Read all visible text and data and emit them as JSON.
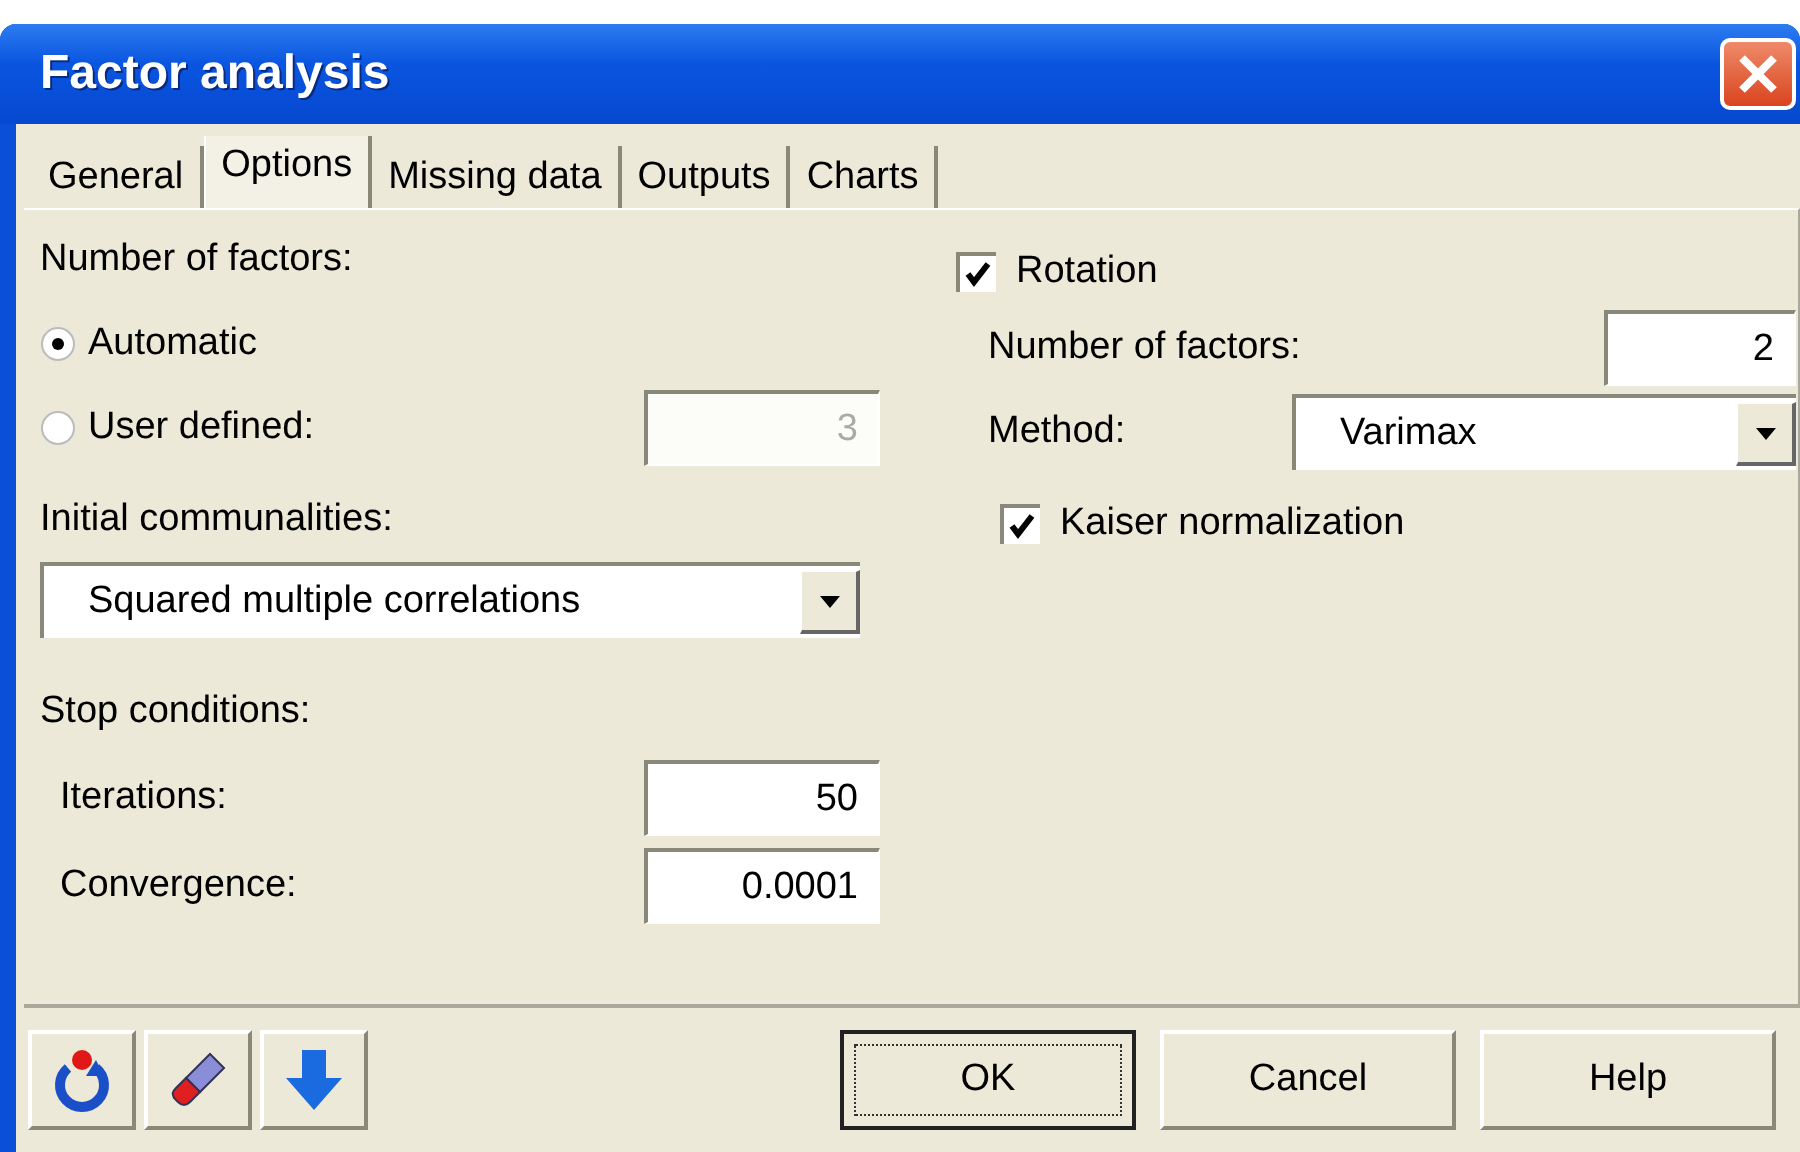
{
  "window": {
    "title": "Factor analysis"
  },
  "tabs": [
    {
      "label": "General",
      "selected": false
    },
    {
      "label": "Options",
      "selected": true
    },
    {
      "label": "Missing data",
      "selected": false
    },
    {
      "label": "Outputs",
      "selected": false
    },
    {
      "label": "Charts",
      "selected": false
    }
  ],
  "number_of_factors": {
    "label": "Number of factors:",
    "options": [
      {
        "label": "Automatic",
        "selected": true
      },
      {
        "label": "User defined:",
        "selected": false
      }
    ],
    "value": "3",
    "disabled": true
  },
  "initial_communalities": {
    "label": "Initial communalities:",
    "value": "Squared multiple correlations"
  },
  "stop_conditions": {
    "label": "Stop conditions:",
    "fields": [
      {
        "label": "Iterations:",
        "value": "50"
      },
      {
        "label": "Convergence:",
        "value": "0.0001"
      }
    ]
  },
  "rotation": {
    "label": "Rotation",
    "checked": true,
    "number_of_factors": {
      "label": "Number of factors:",
      "value": "2"
    },
    "method": {
      "label": "Method:",
      "value": "Varimax"
    },
    "kaiser": {
      "label": "Kaiser normalization",
      "checked": true
    }
  },
  "buttons": [
    {
      "label": "OK",
      "default": true
    },
    {
      "label": "Cancel",
      "default": false
    },
    {
      "label": "Help",
      "default": false
    }
  ]
}
